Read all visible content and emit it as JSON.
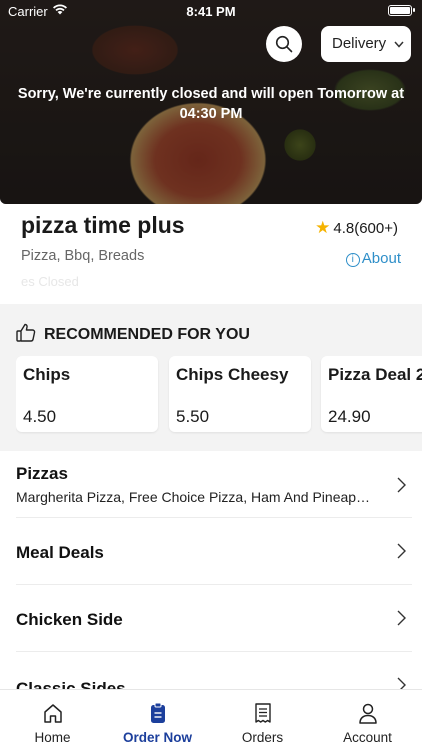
{
  "status_bar": {
    "carrier": "Carrier",
    "time": "8:41 PM"
  },
  "header": {
    "delivery_label": "Delivery",
    "closed_message": "Sorry, We're currently closed and will open Tomorrow at 04:30 PM"
  },
  "restaurant": {
    "name": "pizza time plus",
    "categories": "Pizza, Bbq, Breads",
    "status": "es Closed",
    "rating": "4.8(600+)",
    "about_label": "About"
  },
  "recommended": {
    "title": "RECOMMENDED FOR YOU",
    "items": [
      {
        "name": "Chips",
        "price": "4.50"
      },
      {
        "name": "Chips Cheesy",
        "price": "5.50"
      },
      {
        "name": "Pizza Deal 2",
        "price": "24.90"
      }
    ]
  },
  "menu_categories": [
    {
      "title": "Pizzas",
      "subtitle": "Margherita Pizza, Free Choice Pizza, Ham And Pineap…"
    },
    {
      "title": "Meal Deals",
      "subtitle": ""
    },
    {
      "title": "Chicken Side",
      "subtitle": ""
    },
    {
      "title": "Classic Sides",
      "subtitle": ""
    }
  ],
  "tabbar": {
    "items": [
      {
        "label": "Home",
        "icon": "home-icon"
      },
      {
        "label": "Order Now",
        "icon": "order-icon"
      },
      {
        "label": "Orders",
        "icon": "receipt-icon"
      },
      {
        "label": "Account",
        "icon": "user-icon"
      }
    ],
    "active_color": "#1c3f9c"
  },
  "colors": {
    "accent_link": "#2f8fc9",
    "star": "#f5b301",
    "active_tab": "#1c3f9c"
  }
}
